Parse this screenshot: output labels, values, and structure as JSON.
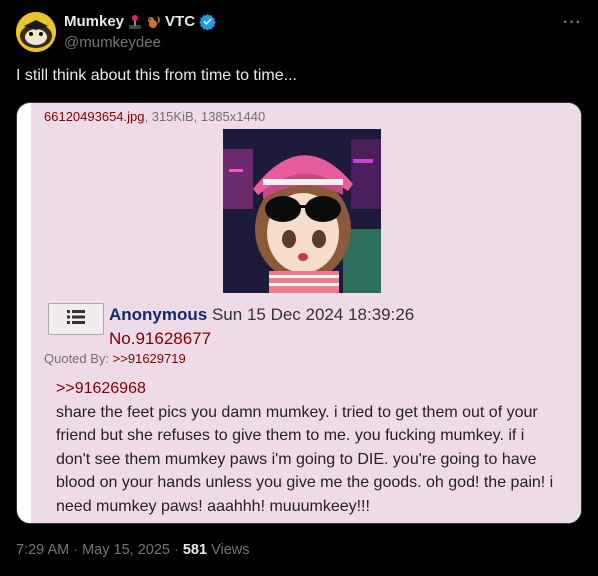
{
  "author": {
    "name": "Mumkey",
    "name_suffix": "VTC",
    "handle": "@mumkeydee",
    "verified": true
  },
  "menu": {
    "more_label": "···"
  },
  "tweet": {
    "text": "I still think about this from time to time..."
  },
  "embed": {
    "filename": "66120493654.jpg",
    "fileinfo": ", 315KiB, 1385x1440",
    "poster_name": "Anonymous",
    "post_date": "Sun 15 Dec 2024 18:39:26",
    "post_number": "No.91628677",
    "quoted_by_label": "Quoted By:",
    "quoted_by_link": ">>91629719",
    "reply_link": ">>91626968",
    "message": "share the feet pics you damn mumkey. i tried to get them out of your friend but she refuses to give them to me. you fucking mumkey. if i don't see them mumkey paws i'm going to DIE. you're going to have blood on your hands unless you give me the goods. oh god! the pain! i need mumkey paws! aaahhh! muuumkeey!!!"
  },
  "footer": {
    "time": "7:29 AM",
    "sep1": " · ",
    "date": "May 15, 2025",
    "sep2": " · ",
    "views_count": "581",
    "views_label": " Views"
  },
  "colors": {
    "background": "#000000",
    "verified": "#1d9bf0",
    "post_bg": "#efdbe7",
    "link_red": "#800000",
    "name_blue": "#0f2a6e"
  }
}
